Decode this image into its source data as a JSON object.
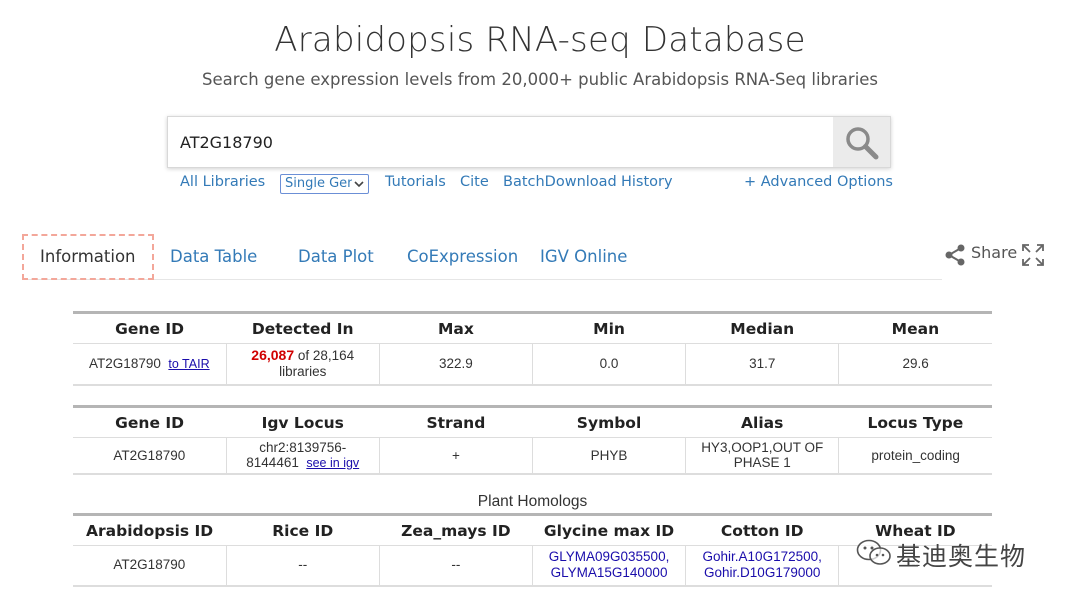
{
  "header": {
    "title": "Arabidopsis RNA-seq Database",
    "subtitle": "Search gene expression levels from 20,000+ public Arabidopsis RNA-Seq libraries"
  },
  "search": {
    "value": "AT2G18790",
    "button_icon": "search-icon"
  },
  "links": {
    "all_libraries": "All Libraries",
    "mode_select": "Single Gene",
    "tutorials": "Tutorials",
    "cite": "Cite",
    "batch_download": "BatchDownload",
    "history": "History",
    "advanced": "+ Advanced Options"
  },
  "tabs": [
    {
      "label": "Information",
      "active": true
    },
    {
      "label": "Data Table"
    },
    {
      "label": "Data Plot"
    },
    {
      "label": "CoExpression"
    },
    {
      "label": "IGV Online"
    }
  ],
  "share": {
    "label": "Share",
    "icon": "share-icon",
    "expand_icon": "expand-icon"
  },
  "summary_table": {
    "headers": [
      "Gene ID",
      "Detected In",
      "Max",
      "Min",
      "Median",
      "Mean"
    ],
    "row": {
      "gene_id": "AT2G18790",
      "tair_link": "to TAIR",
      "detected_count": "26,087",
      "detected_rest": "of 28,164",
      "detected_unit": "libraries",
      "max": "322.9",
      "min": "0.0",
      "median": "31.7",
      "mean": "29.6"
    }
  },
  "locus_table": {
    "headers": [
      "Gene ID",
      "Igv Locus",
      "Strand",
      "Symbol",
      "Alias",
      "Locus Type"
    ],
    "row": {
      "gene_id": "AT2G18790",
      "locus_line1": "chr2:8139756-",
      "locus_line2": "8144461",
      "igv_link": "see in igv",
      "strand": "+",
      "symbol": "PHYB",
      "alias_line1": "HY3,OOP1,OUT OF",
      "alias_line2": "PHASE 1",
      "locus_type": "protein_coding"
    }
  },
  "homologs": {
    "caption": "Plant Homologs",
    "headers": [
      "Arabidopsis ID",
      "Rice ID",
      "Zea_mays ID",
      "Glycine max ID",
      "Cotton ID",
      "Wheat ID"
    ],
    "row": {
      "arabidopsis": "AT2G18790",
      "rice": "--",
      "zea": "--",
      "glycine_1": "GLYMA09G035500,",
      "glycine_2": "GLYMA15G140000",
      "cotton_1": "Gohir.A10G172500,",
      "cotton_2": "Gohir.D10G179000",
      "wheat": "--"
    }
  },
  "watermark": {
    "text": "基迪奥生物",
    "icon": "wechat-icon"
  },
  "colors": {
    "link": "#337ab7",
    "highlight_red": "#d00000",
    "active_tab_border": "#f3a79a"
  }
}
